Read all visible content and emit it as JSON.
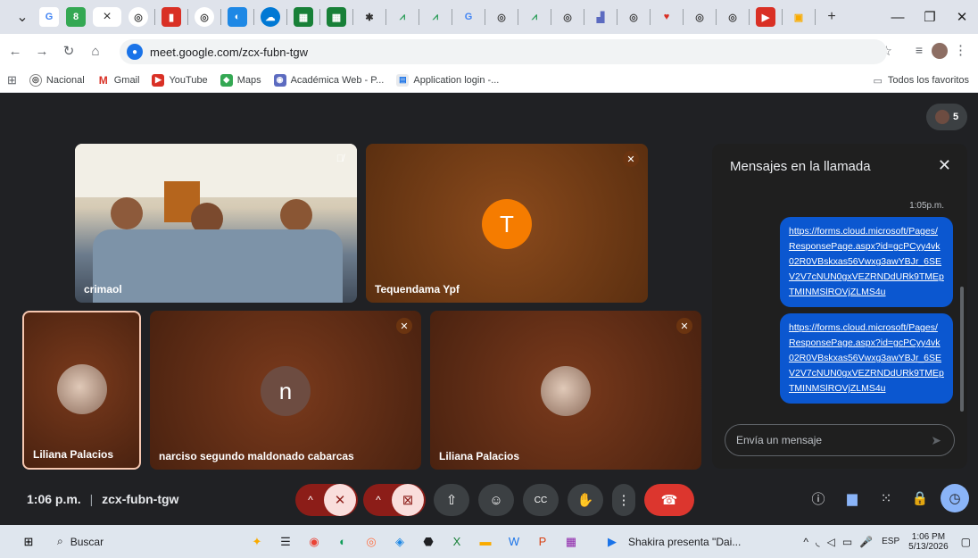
{
  "browser": {
    "url": "meet.google.com/zcx-fubn-tgw",
    "bookmarks": [
      "Nacional",
      "Gmail",
      "YouTube",
      "Maps",
      "Académica Web - P...",
      "Application login -..."
    ],
    "bookmarks_right": "Todos los favoritos"
  },
  "meet": {
    "participant_count": "5",
    "tiles": [
      {
        "name": "crimaol"
      },
      {
        "name": "Tequendama Ypf",
        "initial": "T"
      },
      {
        "name": "Liliana Palacios"
      },
      {
        "name": "narciso segundo maldonado cabarcas",
        "initial": "n"
      },
      {
        "name": "Liliana Palacios"
      }
    ],
    "meeting_time": "1:06 p.m.",
    "meeting_code": "zcx-fubn-tgw"
  },
  "chat": {
    "title": "Mensajes en la llamada",
    "timestamp": "1:05p.m.",
    "messages": [
      "https://forms.cloud.microsoft/Pages/ResponsePage.aspx?id=gcPCyy4vk02R0VBskxas56Vwxg3awYBJr_6SEV2V7cNUN0gxVEZRNDdURk9TMEpTMINMSlROVjZLMS4u",
      "https://forms.cloud.microsoft/Pages/ResponsePage.aspx?id=gcPCyy4vk02R0VBskxas56Vwxg3awYBJr_6SEV2V7cNUN0gxVEZRNDdURk9TMEpTMINMSlROVjZLMS4u"
    ],
    "input_placeholder": "Envía un mensaje"
  },
  "taskbar": {
    "search": "Buscar",
    "media_title": "Shakira presenta \"Dai...",
    "lang": "ESP",
    "time": "1:06 PM",
    "date": "5/13/2026"
  }
}
